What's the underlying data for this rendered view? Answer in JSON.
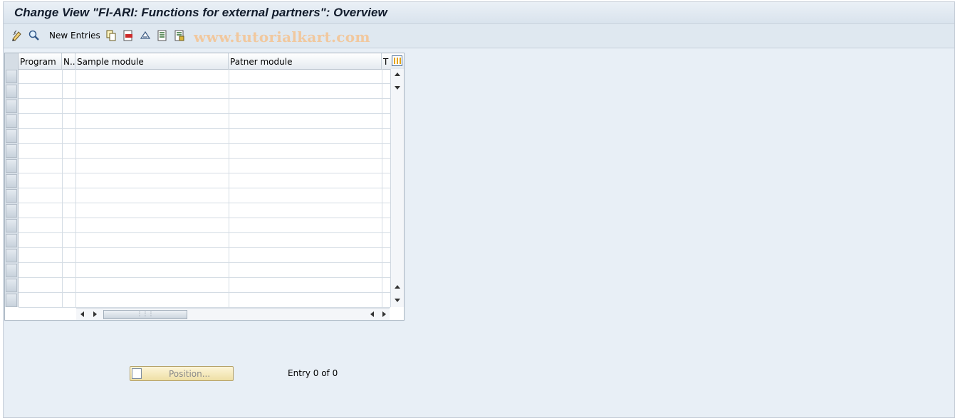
{
  "window": {
    "title": "Change View \"FI-ARI: Functions for external partners\": Overview"
  },
  "toolbar": {
    "new_entries_label": "New Entries",
    "icons": [
      "display-change-icon",
      "display-icon",
      "copy-icon",
      "delete-icon",
      "undo-icon",
      "select-all-icon",
      "deselect-all-icon"
    ],
    "watermark": "www.tutorialkart.com"
  },
  "table": {
    "columns": [
      {
        "label": "Program"
      },
      {
        "label": "N.."
      },
      {
        "label": "Sample module"
      },
      {
        "label": "Patner module"
      },
      {
        "label": "T"
      }
    ],
    "row_count": 16
  },
  "footer": {
    "position_label": "Position...",
    "entry_text": "Entry 0 of 0"
  }
}
